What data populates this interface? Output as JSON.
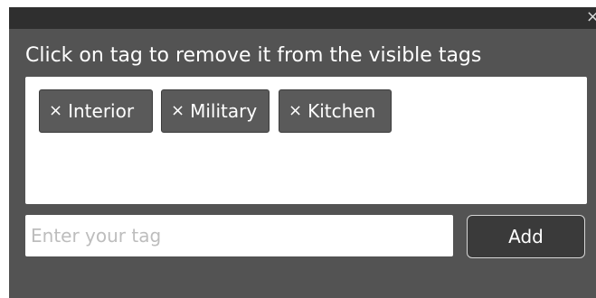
{
  "dialog": {
    "close_glyph": "×",
    "instruction": "Click on tag to remove it from the visible tags"
  },
  "tags": [
    {
      "remove_glyph": "×",
      "label": "Interior"
    },
    {
      "remove_glyph": "×",
      "label": "Military"
    },
    {
      "remove_glyph": "×",
      "label": "Kitchen"
    }
  ],
  "input": {
    "value": "",
    "placeholder": "Enter your tag"
  },
  "add_button": {
    "label": "Add"
  },
  "colors": {
    "dialog_background": "#535353",
    "titlebar": "#2f2f2f",
    "tag_background": "#5a5a5a",
    "button_background": "#3a3a3a"
  }
}
